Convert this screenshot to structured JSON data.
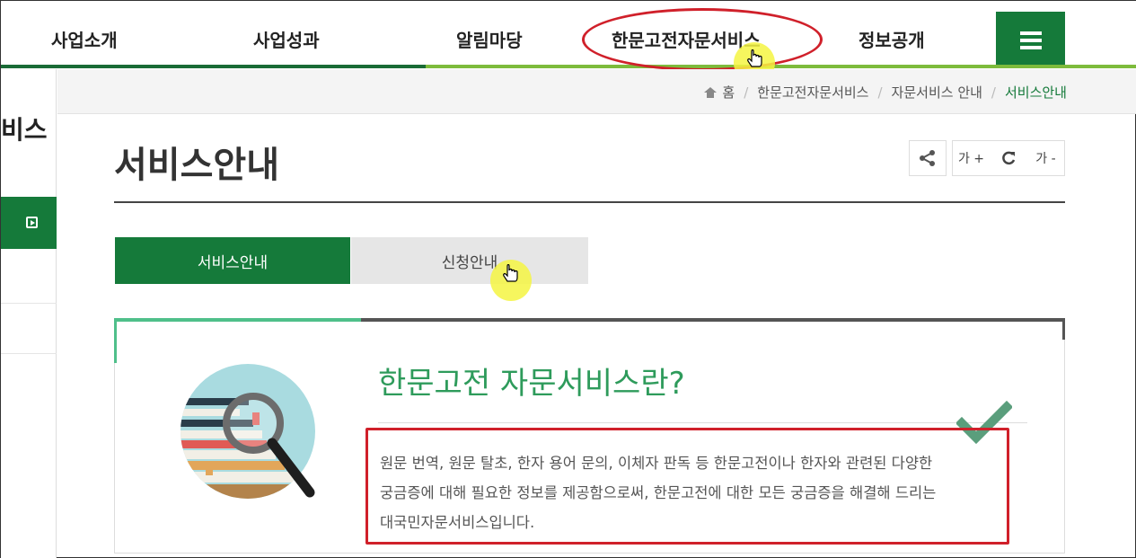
{
  "nav": {
    "items": [
      "사업소개",
      "사업성과",
      "알림마당",
      "한문고전자문서비스",
      "정보공개"
    ],
    "menu_icon": "hamburger-icon"
  },
  "sidebar": {
    "title": "비스",
    "active_icon": "play-square-icon"
  },
  "breadcrumb": {
    "home_icon": "home-icon",
    "items": [
      "홈",
      "한문고전자문서비스",
      "자문서비스 안내",
      "서비스안내"
    ]
  },
  "page": {
    "title": "서비스안내",
    "tools": {
      "share_icon": "share-icon",
      "font_up": "가 +",
      "refresh_icon": "refresh-icon",
      "font_down": "가 -"
    }
  },
  "tabs": [
    {
      "label": "서비스안내",
      "active": true
    },
    {
      "label": "신청안내",
      "active": false
    }
  ],
  "about": {
    "title": "한문고전 자문서비스란?",
    "lines": [
      "원문 번역, 원문 탈초, 한자 용어 문의, 이체자 판독 등 한문고전이나 한자와 관련된 다양한",
      "궁금증에 대해 필요한 정보를 제공함으로써, 한문고전에 대한 모든 궁금증을 해결해 드리는",
      "대국민자문서비스입니다."
    ],
    "illustration_icon": "magnifier-books-icon",
    "check_icon": "check-icon"
  },
  "colors": {
    "brand_green": "#157a3a",
    "accent_green": "#2e9b5b",
    "annotation_red": "#d0202a"
  }
}
